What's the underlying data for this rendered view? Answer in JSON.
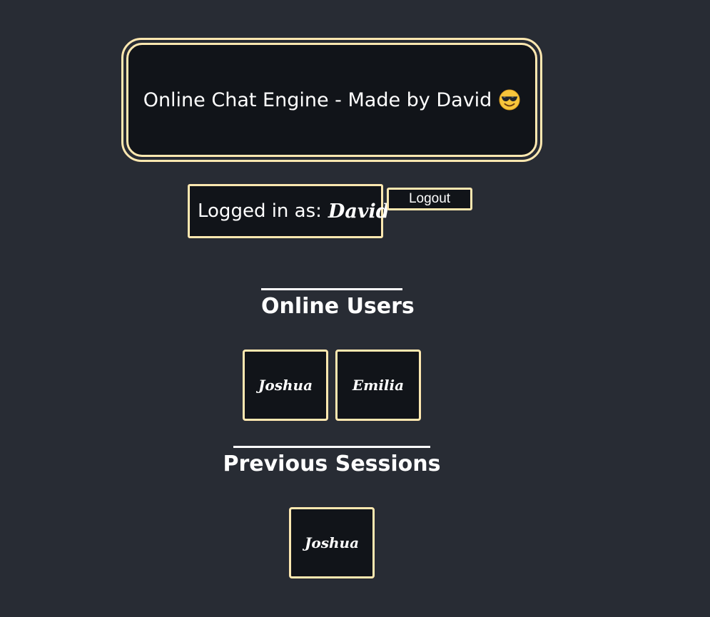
{
  "header": {
    "title": "Online Chat Engine - Made by David",
    "emoji_icon": "smiling-face-with-sunglasses-icon"
  },
  "session": {
    "logged_in_label": "Logged in as:",
    "username": "David",
    "logout_label": "Logout"
  },
  "online_users": {
    "heading": "Online Users",
    "users": [
      "Joshua",
      "Emilia"
    ]
  },
  "previous_sessions": {
    "heading": "Previous Sessions",
    "users": [
      "Joshua"
    ]
  },
  "colors": {
    "background": "#282c34",
    "panel": "#111419",
    "accent_border": "#ffe8b0",
    "text": "#ffffff"
  }
}
